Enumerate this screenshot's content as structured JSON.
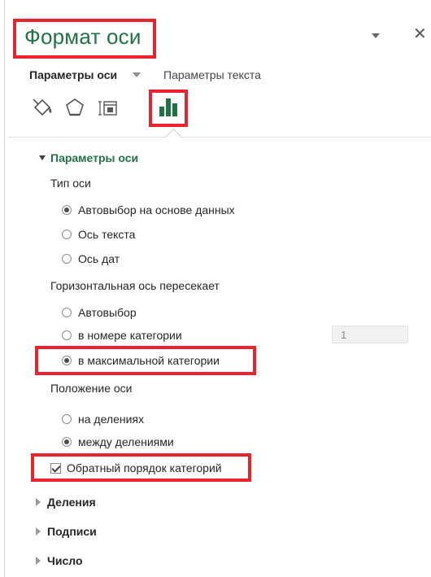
{
  "pane": {
    "title": "Формат оси",
    "tabs": {
      "axis_options": "Параметры оси",
      "text_options": "Параметры текста"
    },
    "icons": [
      "fill-line-icon",
      "effects-pentagon-icon",
      "size-properties-icon",
      "axis-options-chart-icon"
    ]
  },
  "section": {
    "header": "Параметры оси",
    "axis_type_label": "Тип оси",
    "axis_type_options": [
      {
        "label": "Автовыбор на основе данных",
        "selected": true
      },
      {
        "label": "Ось текста",
        "selected": false
      },
      {
        "label": "Ось дат",
        "selected": false
      }
    ],
    "crosses_label": "Горизонтальная ось пересекает",
    "crosses_options": [
      {
        "label": "Автовыбор",
        "selected": false
      },
      {
        "label": "в номере категории",
        "selected": false
      },
      {
        "label": "в максимальной категории",
        "selected": true
      }
    ],
    "category_number_value": "1",
    "position_label": "Положение оси",
    "position_options": [
      {
        "label": "на делениях",
        "selected": false
      },
      {
        "label": "между делениями",
        "selected": true
      }
    ],
    "reverse_order": {
      "label": "Обратный порядок категорий",
      "checked": true
    }
  },
  "collapsed_sections": [
    "Деления",
    "Подписи",
    "Число"
  ],
  "colors": {
    "accent_green": "#217346",
    "highlight_red": "#e8242f"
  }
}
